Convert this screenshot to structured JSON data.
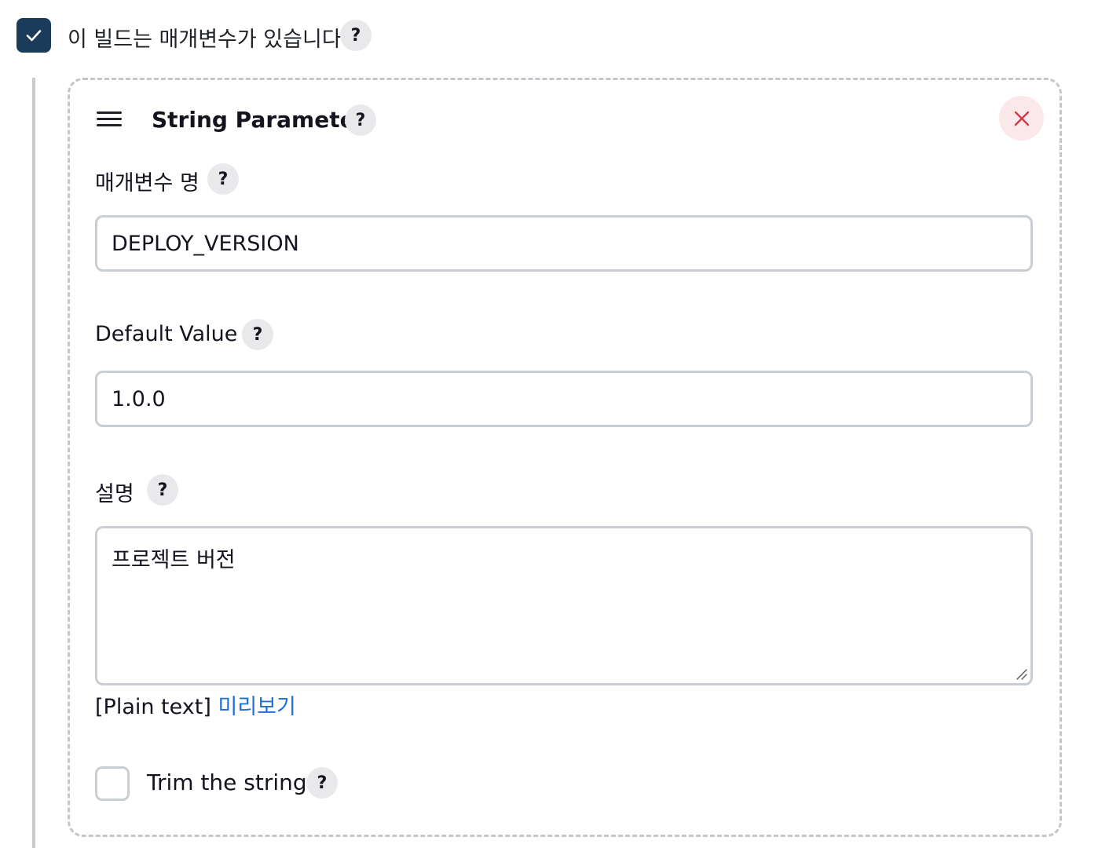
{
  "build_params": {
    "checkbox_checked": true,
    "label": "이 빌드는 매개변수가 있습니다",
    "help": "?"
  },
  "parameter": {
    "type_title": "String Parameter",
    "help": "?",
    "delete_icon": "close-icon",
    "name_field": {
      "label": "매개변수 명",
      "help": "?",
      "value": "DEPLOY_VERSION"
    },
    "default_field": {
      "label": "Default Value",
      "help": "?",
      "value": "1.0.0"
    },
    "description_field": {
      "label": "설명",
      "help": "?",
      "value": "프로젝트 버전",
      "format_note": "[Plain text]",
      "preview_link": "미리보기"
    },
    "trim": {
      "checked": false,
      "label": "Trim the string",
      "help": "?"
    }
  },
  "colors": {
    "checkbox_checked_bg": "#1b3b5a",
    "link": "#1f6fd6",
    "delete_bg": "#fbe8ea",
    "delete_icon": "#d33a49"
  }
}
